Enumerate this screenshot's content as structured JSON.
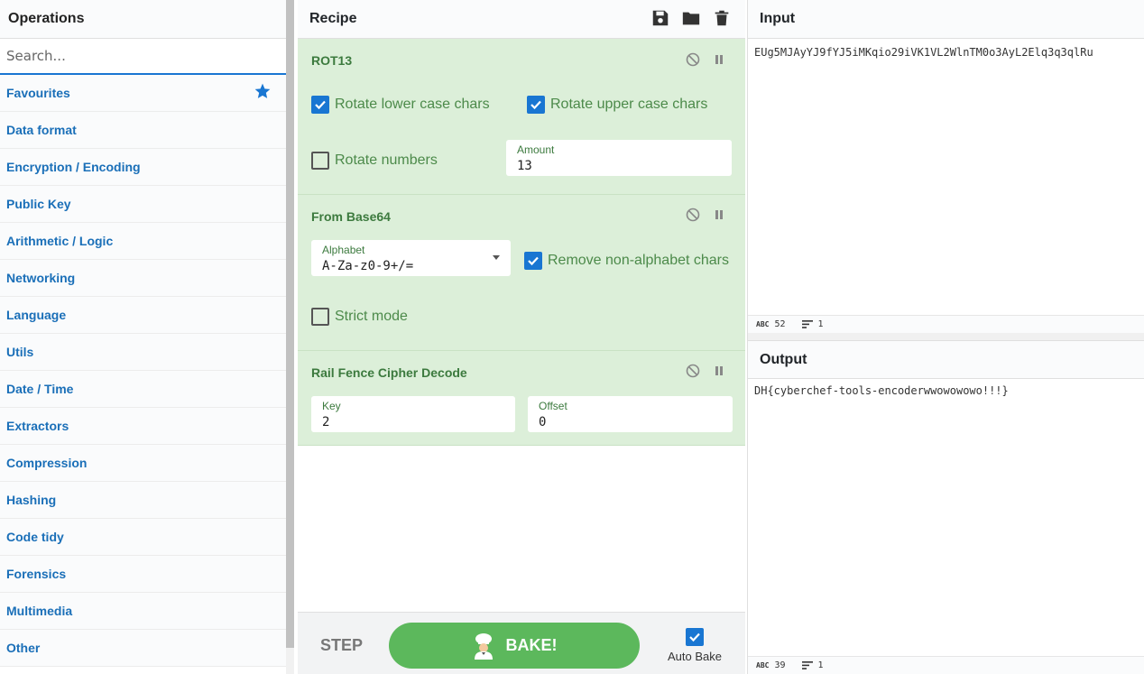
{
  "operations": {
    "title": "Operations",
    "search_placeholder": "Search...",
    "categories": [
      "Favourites",
      "Data format",
      "Encryption / Encoding",
      "Public Key",
      "Arithmetic / Logic",
      "Networking",
      "Language",
      "Utils",
      "Date / Time",
      "Extractors",
      "Compression",
      "Hashing",
      "Code tidy",
      "Forensics",
      "Multimedia",
      "Other"
    ]
  },
  "recipe": {
    "title": "Recipe",
    "icons": [
      "save-icon",
      "folder-icon",
      "trash-icon"
    ],
    "rot13": {
      "title": "ROT13",
      "lower_label": "Rotate lower case chars",
      "lower_checked": true,
      "upper_label": "Rotate upper case chars",
      "upper_checked": true,
      "numbers_label": "Rotate numbers",
      "numbers_checked": false,
      "amount_label": "Amount",
      "amount_value": "13"
    },
    "base64": {
      "title": "From Base64",
      "alphabet_label": "Alphabet",
      "alphabet_value": "A-Za-z0-9+/=",
      "remove_label": "Remove non-alphabet chars",
      "remove_checked": true,
      "strict_label": "Strict mode",
      "strict_checked": false
    },
    "railfence": {
      "title": "Rail Fence Cipher Decode",
      "key_label": "Key",
      "key_value": "2",
      "offset_label": "Offset",
      "offset_value": "0"
    },
    "controls": {
      "step_label": "STEP",
      "bake_label": "BAKE!",
      "autobake_label": "Auto Bake",
      "autobake_checked": true
    }
  },
  "input": {
    "title": "Input",
    "text": "EUg5MJAyYJ9fYJ5iMKqio29iVK1VL2WlnTM0o3AyL2Elq3q3qlRu",
    "length": "52",
    "lines": "1"
  },
  "output": {
    "title": "Output",
    "text": "DH{cyberchef-tools-encoderwwowowowo!!!}",
    "length": "39",
    "lines": "1"
  },
  "colors": {
    "accent": "#1976d2",
    "op_bg": "#dcefd9",
    "bake": "#5cb85c",
    "category_text": "#1a6fb8"
  }
}
